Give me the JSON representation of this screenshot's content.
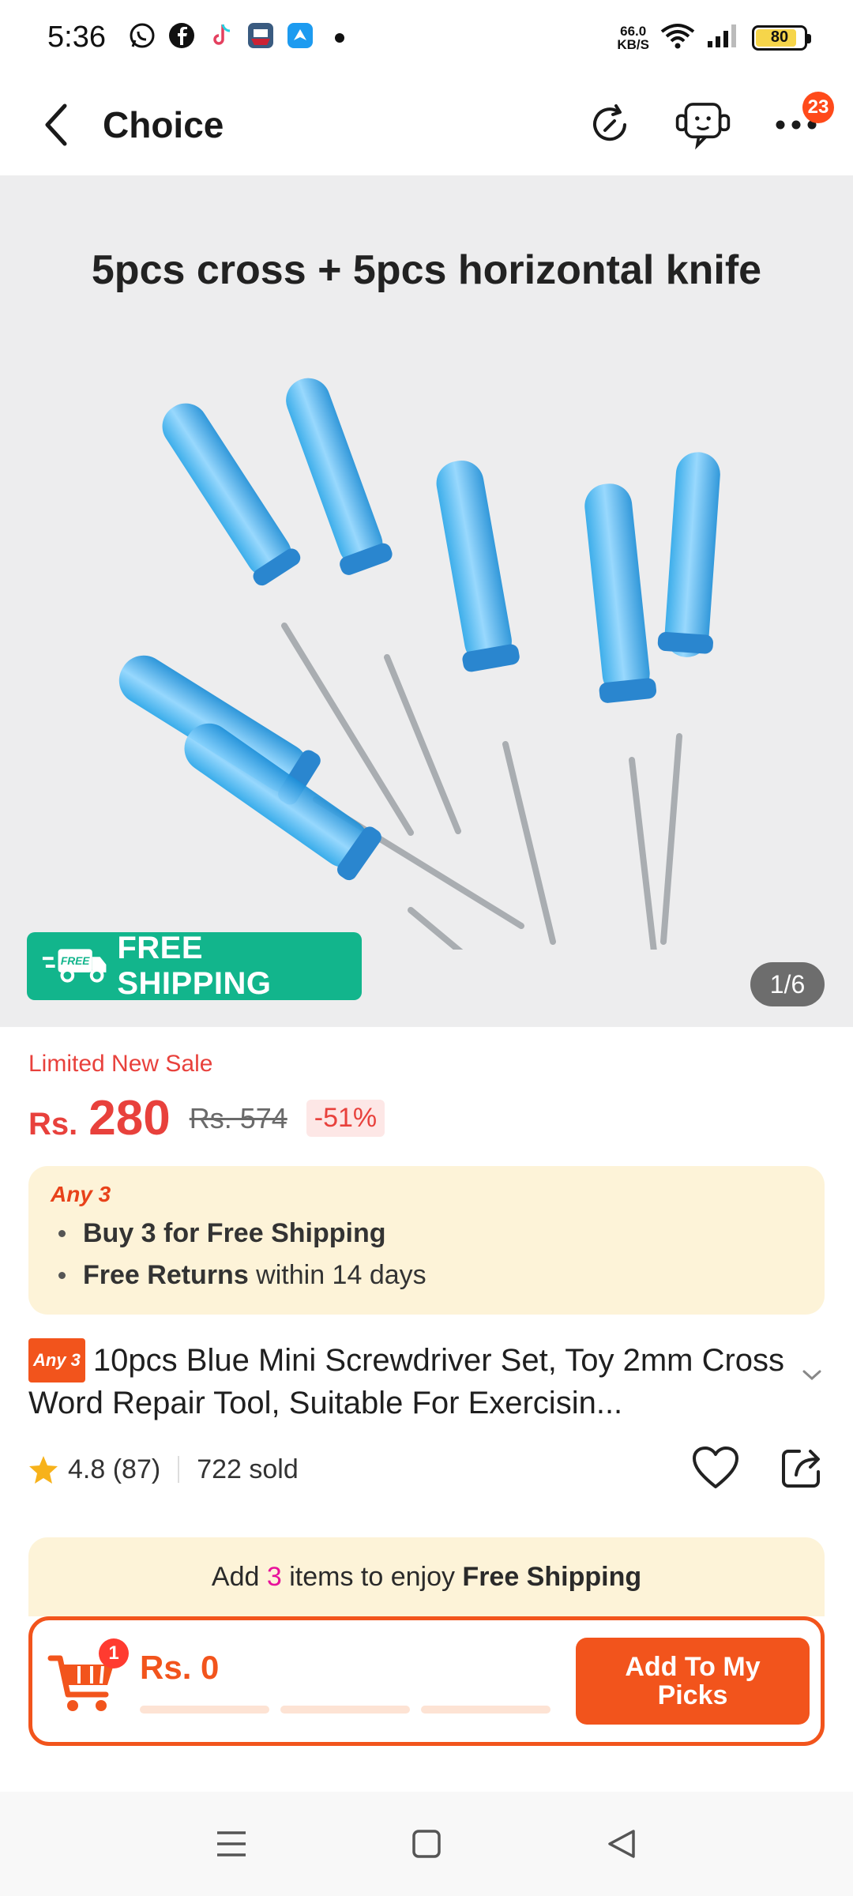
{
  "status_bar": {
    "time": "5:36",
    "net_speed_value": "66.0",
    "net_speed_unit": "KB/S",
    "battery": "80",
    "battery_level": 0.8
  },
  "nav": {
    "title": "Choice",
    "badge_count": "23"
  },
  "hero": {
    "caption": "5pcs cross + 5pcs horizontal knife",
    "free_shipping_label": "FREE SHIPPING",
    "free_icon_text": "FREE",
    "pager": "1/6"
  },
  "price": {
    "sale_label": "Limited New Sale",
    "currency": "Rs.",
    "current": "280",
    "original": "Rs. 574",
    "discount": "-51%"
  },
  "promo": {
    "tag": "Any 3",
    "line1_bold": "Buy 3 for  Free Shipping",
    "line2_bold": "Free Returns",
    "line2_rest": " within 14 days"
  },
  "product": {
    "tag": "Any 3",
    "title": "10pcs Blue Mini Screwdriver Set, Toy 2mm Cross Word Repair Tool, Suitable For Exercisin..."
  },
  "rating": {
    "value": "4.8 (87)",
    "sold": "722 sold"
  },
  "picks": {
    "banner_pre": "Add ",
    "banner_num": "3",
    "banner_mid": " items to enjoy ",
    "banner_bold": "Free Shipping",
    "cart_count": "1",
    "total": "Rs. 0",
    "button": "Add To My Picks"
  },
  "colors": {
    "accent": "#f2541c",
    "price_red": "#e8413c",
    "free_green": "#12b58c",
    "promo_bg": "#fdf3d8"
  }
}
